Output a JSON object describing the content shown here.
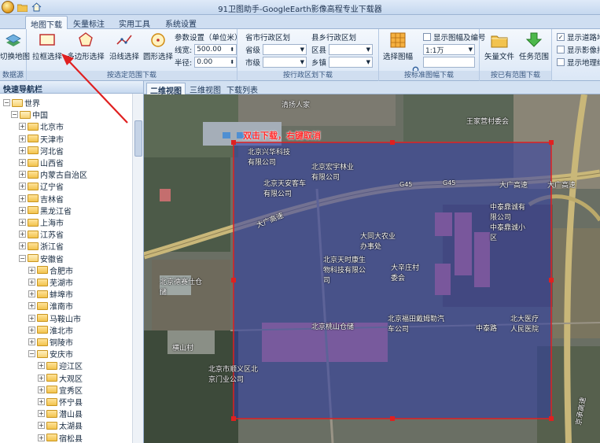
{
  "window": {
    "title": "91卫图助手-GoogleEarth影像高程专业下载器"
  },
  "quick_access": [
    "folder-icon",
    "home-icon"
  ],
  "tabs": [
    "地图下载",
    "矢量标注",
    "实用工具",
    "系统设置"
  ],
  "ribbon": {
    "datasource": {
      "button": "切换地图",
      "label": "数据源"
    },
    "select_range": {
      "label": "按选定范围下载",
      "buttons": [
        "拉框选择",
        "多边形选择",
        "沿线选择",
        "圆形选择"
      ],
      "params_title": "参数设置（单位米）",
      "line_width_label": "线宽:",
      "line_width_value": "500.00",
      "radius_label": "半径:",
      "radius_value": "0.00"
    },
    "city_region": {
      "title": "省市行政区划",
      "province_label": "省级",
      "city_label": "市级",
      "label": "按行政区划下载"
    },
    "county_region": {
      "title": "县乡行政区划",
      "county_label": "区县",
      "town_label": "乡镇"
    },
    "standard_sheet": {
      "button": "选择图幅",
      "show_sheet_label": "显示图幅及编号",
      "scale_value": "1:1万",
      "label": "按标准图幅下载"
    },
    "existing": {
      "buttons": [
        "矢量文件",
        "任务范围"
      ],
      "label": "按已有范围下载"
    },
    "display": {
      "options": [
        "显示道路地",
        "显示影像拍",
        "显示地理结"
      ],
      "checked": [
        true,
        false,
        false
      ]
    }
  },
  "panel": {
    "title": "快速导航栏",
    "tree": [
      {
        "label": "世界",
        "level": 0,
        "open": true
      },
      {
        "label": "中国",
        "level": 1,
        "open": true
      },
      {
        "label": "北京市",
        "level": 2
      },
      {
        "label": "天津市",
        "level": 2
      },
      {
        "label": "河北省",
        "level": 2
      },
      {
        "label": "山西省",
        "level": 2
      },
      {
        "label": "内蒙古自治区",
        "level": 2
      },
      {
        "label": "辽宁省",
        "level": 2
      },
      {
        "label": "吉林省",
        "level": 2
      },
      {
        "label": "黑龙江省",
        "level": 2
      },
      {
        "label": "上海市",
        "level": 2
      },
      {
        "label": "江苏省",
        "level": 2
      },
      {
        "label": "浙江省",
        "level": 2
      },
      {
        "label": "安徽省",
        "level": 2,
        "open": true
      },
      {
        "label": "合肥市",
        "level": 3
      },
      {
        "label": "芜湖市",
        "level": 3
      },
      {
        "label": "蚌埠市",
        "level": 3
      },
      {
        "label": "淮南市",
        "level": 3
      },
      {
        "label": "马鞍山市",
        "level": 3
      },
      {
        "label": "淮北市",
        "level": 3
      },
      {
        "label": "铜陵市",
        "level": 3
      },
      {
        "label": "安庆市",
        "level": 3,
        "open": true
      },
      {
        "label": "迎江区",
        "level": 4
      },
      {
        "label": "大观区",
        "level": 4
      },
      {
        "label": "宜秀区",
        "level": 4
      },
      {
        "label": "怀宁县",
        "level": 4
      },
      {
        "label": "潜山县",
        "level": 4
      },
      {
        "label": "太湖县",
        "level": 4
      },
      {
        "label": "宿松县",
        "level": 4
      }
    ]
  },
  "map_tabs": [
    "二维视图",
    "三维视图",
    "下载列表"
  ],
  "map": {
    "instruction": "双击下载，右键取消",
    "labels": [
      "清扬人家",
      "王家营村委会",
      "北京兴华科技有限公司",
      "北京宏宇林业有限公司",
      "北京天安客车有限公司",
      "G45",
      "G45",
      "大广高速",
      "大广高速",
      "大广高速",
      "中泰鼎诚有限公司",
      "中泰鼎诚小区",
      "大同大农业办事处",
      "北京天时康生物科技有限公司",
      "大辛庄村委会",
      "北京德赛仕仓储",
      "北京桃山仓储",
      "北京福田戴姆勒汽车公司",
      "中泰路",
      "北大医疗人民医院",
      "横山村",
      "北京市顺义区北京门业公司",
      "京承高速"
    ]
  }
}
